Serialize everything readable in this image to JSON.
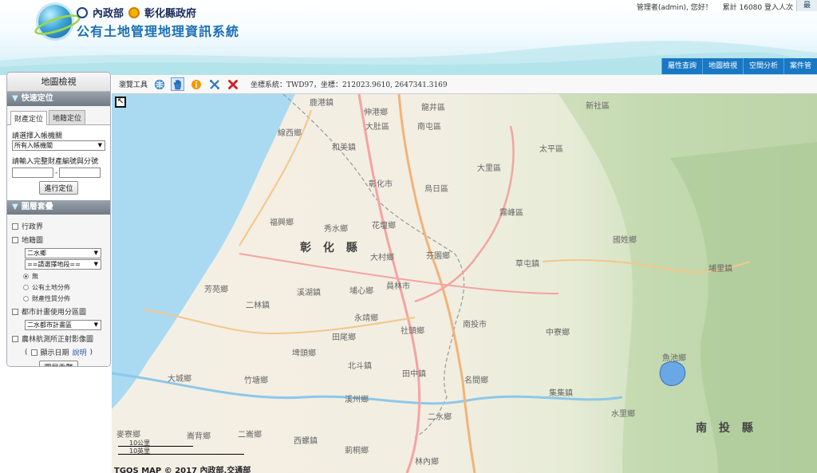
{
  "header": {
    "gov_moi": "內政部",
    "gov_changhua": "彰化縣政府",
    "site_title": "公有土地管理地理資訊系統",
    "user_greeting": "管理者(admin), 您好！",
    "visitor_count": "累計 16080 登入人次",
    "corner_button": "最"
  },
  "main_nav": [
    "屬性查詢",
    "地圖檢視",
    "空間分析",
    "案件管"
  ],
  "panel": {
    "title": "地圖檢視",
    "quick_locate": {
      "header": "快速定位",
      "tabs": [
        "財產定位",
        "地籍定位"
      ],
      "agency_label": "請選擇入帳機關",
      "agency_value": "所有入帳機關",
      "property_label": "請輸入完整財產編號與分號",
      "property_main": "",
      "property_sub": "",
      "locate_button": "進行定位"
    },
    "layers": {
      "header": "圖層套疊",
      "admin_boundary": "行政界",
      "cadastral": "地籍圖",
      "township_select": "二水鄉",
      "section_select": "==請選擇地段==",
      "radio_none": "無",
      "radio_public": "公有土地分佈",
      "radio_property": "財產性質分佈",
      "urban_zoning": "都市計畫使用分區圖",
      "urban_select": "二水都市計畫區",
      "aerial": "農林航測所正射影像圖",
      "show_date": "顯示日期",
      "explain_link": "說明",
      "reset_button": "圖層重整"
    }
  },
  "toolbar": {
    "label": "瀏覽工具",
    "coords": "坐標系統：TWD97，坐標：212023.9610, 2647341.3169",
    "icons": [
      "globe-icon",
      "pan-hand-icon",
      "info-icon",
      "measure-icon",
      "clear-icon"
    ]
  },
  "map": {
    "places": [
      "鹿港鎮",
      "線西鄉",
      "和美鎮",
      "伸港鄉",
      "大肚區",
      "龍井區",
      "南屯區",
      "烏日區",
      "大里區",
      "太平區",
      "新社區",
      "霧峰區",
      "國姓鄉",
      "草屯鎮",
      "埔里鎮",
      "彰化市",
      "芬園鄉",
      "花壇鄉",
      "秀水鄉",
      "福興鄉",
      "大村鄉",
      "員林市",
      "埔心鄉",
      "溪湖鎮",
      "芳苑鄉",
      "二林鎮",
      "永靖鄉",
      "社頭鄉",
      "田尾鄉",
      "埤頭鄉",
      "北斗鎮",
      "南投市",
      "中寮鄉",
      "魚池鄉",
      "名間鄉",
      "田中鎮",
      "集集鎮",
      "水里鄉",
      "溪州鄉",
      "二水鄉",
      "大城鄉",
      "竹塘鄉",
      "麥寮鄉",
      "崙背鄉",
      "二崙鄉",
      "西螺鎮",
      "莿桐鄉",
      "林內鄉"
    ],
    "county_changhua": "彰 化 縣",
    "county_nantou": "南 投 縣",
    "scale_km": "10公里",
    "scale_mi": "10英里",
    "copyright": "TGOS MAP © 2017 內政部,交通部"
  }
}
